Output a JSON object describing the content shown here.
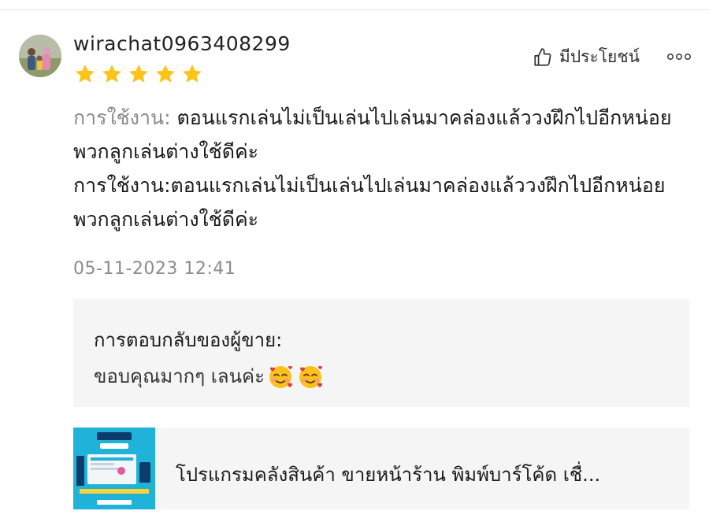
{
  "review": {
    "username": "wirachat0963408299",
    "rating": 5,
    "helpful_label": "มีประโยชน์",
    "usage_label": "การใช้งาน:",
    "usage_text": " ตอนแรกเล่นไม่เป็นเล่นไปเล่นมาคล่องแล้ววงฝึกไปอีกหน่อยพวกลูกเล่นต่างใช้ดีค่ะ",
    "full_text": "การใช้งาน:ตอนแรกเล่นไม่เป็นเล่นไปเล่นมาคล่องแล้ววงฝึกไปอีกหน่อยพวกลูกเล่นต่างใช้ดีค่ะ",
    "timestamp": "05-11-2023 12:41"
  },
  "seller_reply": {
    "title": "การตอบกลับของผู้ขาย:",
    "text": "ขอบคุณมากๆ เลนค่ะ"
  },
  "product": {
    "name": "โปรแกรมคลังสินค้า ขายหน้าร้าน พิมพ์บาร์โค้ด เชื่..."
  },
  "colors": {
    "star": "#fcc419",
    "thumb_bg": "#1fb3d9",
    "box_bg": "#f5f5f5"
  }
}
